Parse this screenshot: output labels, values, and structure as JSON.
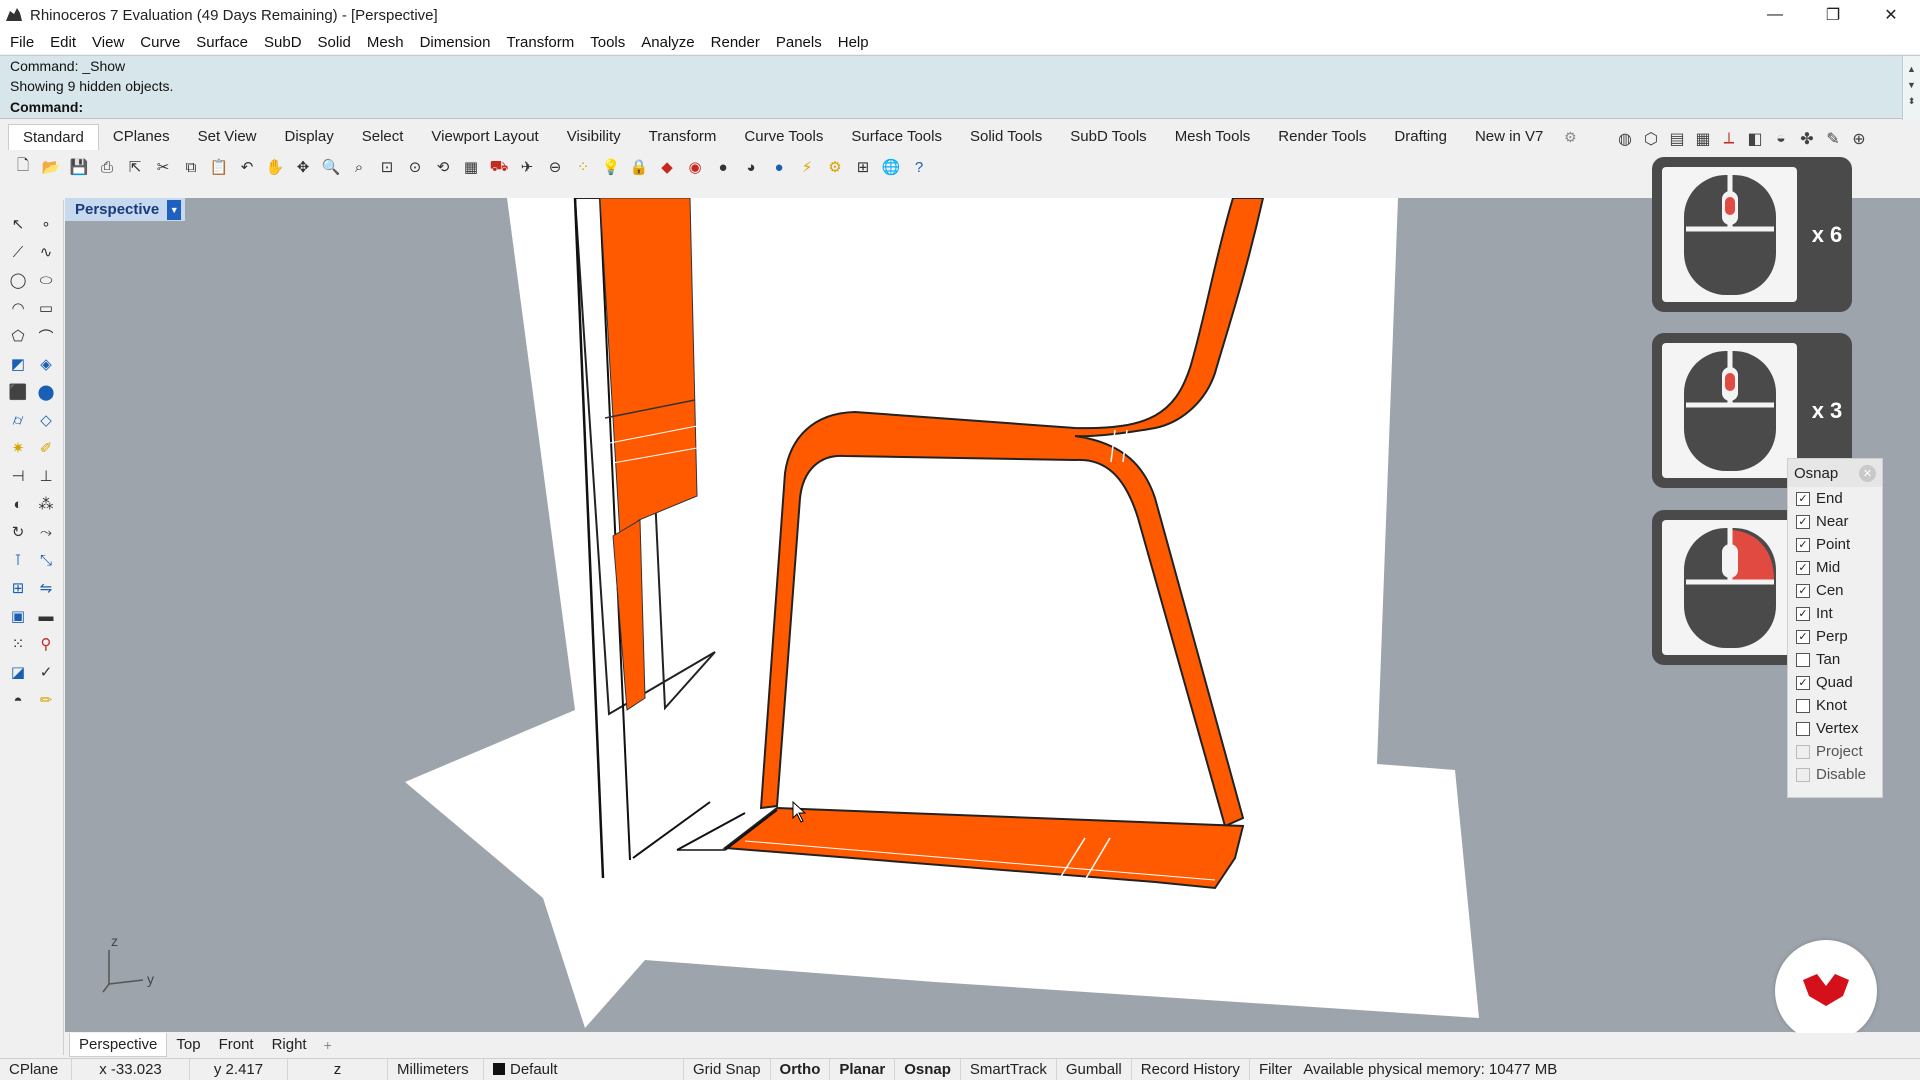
{
  "window": {
    "title": "Rhinoceros 7 Evaluation (49 Days Remaining) - [Perspective]",
    "controls": [
      "—",
      "❐",
      "✕"
    ]
  },
  "menu": [
    "File",
    "Edit",
    "View",
    "Curve",
    "Surface",
    "SubD",
    "Solid",
    "Mesh",
    "Dimension",
    "Transform",
    "Tools",
    "Analyze",
    "Render",
    "Panels",
    "Help"
  ],
  "command": {
    "history": [
      "Command: _Show",
      "Showing 9 hidden objects."
    ],
    "prompt": "Command:"
  },
  "toolbar_tabs": [
    "Standard",
    "CPlanes",
    "Set View",
    "Display",
    "Select",
    "Viewport Layout",
    "Visibility",
    "Transform",
    "Curve Tools",
    "Surface Tools",
    "Solid Tools",
    "SubD Tools",
    "Mesh Tools",
    "Render Tools",
    "Drafting",
    "New in V7"
  ],
  "viewport": {
    "label": "Perspective",
    "axes": {
      "z": "z",
      "y": "y"
    }
  },
  "mouse_overlays": [
    {
      "count": "x 6",
      "button": "middle-button"
    },
    {
      "count": "x 3",
      "button": "middle-button"
    },
    {
      "count": "",
      "button": "right-button"
    }
  ],
  "osnap": {
    "title": "Osnap",
    "items": [
      {
        "label": "End",
        "checked": true
      },
      {
        "label": "Near",
        "checked": true
      },
      {
        "label": "Point",
        "checked": true
      },
      {
        "label": "Mid",
        "checked": true
      },
      {
        "label": "Cen",
        "checked": true
      },
      {
        "label": "Int",
        "checked": true
      },
      {
        "label": "Perp",
        "checked": true
      },
      {
        "label": "Tan",
        "checked": false
      },
      {
        "label": "Quad",
        "checked": true
      },
      {
        "label": "Knot",
        "checked": false
      },
      {
        "label": "Vertex",
        "checked": false
      },
      {
        "label": "Project",
        "checked": false,
        "dim": true
      },
      {
        "label": "Disable",
        "checked": false,
        "dim": true
      }
    ]
  },
  "viewport_tabs": [
    "Perspective",
    "Top",
    "Front",
    "Right"
  ],
  "status": {
    "cplane": "CPlane",
    "x": "x -33.023",
    "y": "y 2.417",
    "z": "z",
    "units": "Millimeters",
    "layer": "Default",
    "toggles": [
      {
        "label": "Grid Snap",
        "bold": false
      },
      {
        "label": "Ortho",
        "bold": true
      },
      {
        "label": "Planar",
        "bold": true
      },
      {
        "label": "Osnap",
        "bold": true
      },
      {
        "label": "SmartTrack",
        "bold": false
      },
      {
        "label": "Gumball",
        "bold": false
      },
      {
        "label": "Record History",
        "bold": false
      },
      {
        "label": "Filter",
        "bold": false
      }
    ],
    "memory": "Available physical memory: 10477 MB"
  },
  "colors": {
    "accent_orange": "#ff5a00",
    "viewport_bg": "#9ea4ab",
    "command_bg": "#d7e6ea",
    "brand_red": "#d4101a"
  }
}
